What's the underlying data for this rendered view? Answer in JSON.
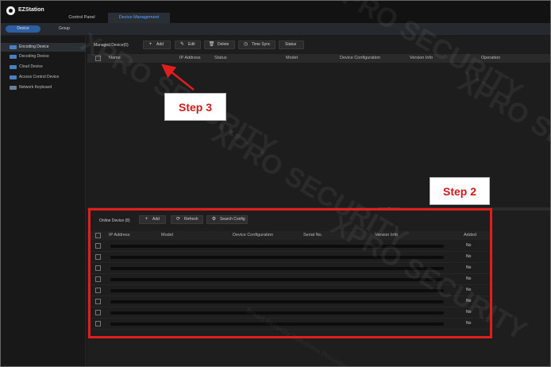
{
  "app": {
    "title": "EZStation"
  },
  "top_tabs": {
    "control_panel": "Control Panel",
    "device_management": "Device Management"
  },
  "sub_tabs": {
    "device": "Device",
    "group": "Group"
  },
  "sidebar": {
    "items": [
      {
        "label": "Encoding Device",
        "icon": "encoder-icon",
        "active": true
      },
      {
        "label": "Decoding Device",
        "icon": "decoder-icon",
        "active": false
      },
      {
        "label": "Cloud Device",
        "icon": "cloud-device-icon",
        "active": false
      },
      {
        "label": "Access Control Device",
        "icon": "access-control-icon",
        "active": false
      },
      {
        "label": "Network Keyboard",
        "icon": "keyboard-icon",
        "active": false
      }
    ]
  },
  "managed": {
    "label": "Managed Device(0)",
    "buttons": {
      "add": "Add",
      "edit": "Edit",
      "delete": "Delete",
      "time_sync": "Time Sync",
      "status": "Status"
    },
    "columns": {
      "name": "Name",
      "ip": "IP Address",
      "status": "Status",
      "model": "Model",
      "config": "Device Configuration",
      "version": "Version Info",
      "operation": "Operation"
    }
  },
  "online": {
    "label": "Online Device (8)",
    "buttons": {
      "add": "Add",
      "refresh": "Refresh",
      "search_config": "Search Config"
    },
    "columns": {
      "ip": "IP Address",
      "model": "Model",
      "config": "Device Configuration",
      "serial": "Serial No.",
      "version": "Version Info",
      "added": "Added"
    },
    "rows": [
      {
        "added": "No"
      },
      {
        "added": "No"
      },
      {
        "added": "No"
      },
      {
        "added": "No"
      },
      {
        "added": "No"
      },
      {
        "added": "No"
      },
      {
        "added": "No"
      },
      {
        "added": "No"
      }
    ]
  },
  "annotations": {
    "step3": "Step 3",
    "step2": "Step 2",
    "highlight_color": "#e01e1e"
  },
  "watermark": {
    "brand": "XPRO SECURITY",
    "tagline": "Smart Security Solutions Provider"
  }
}
